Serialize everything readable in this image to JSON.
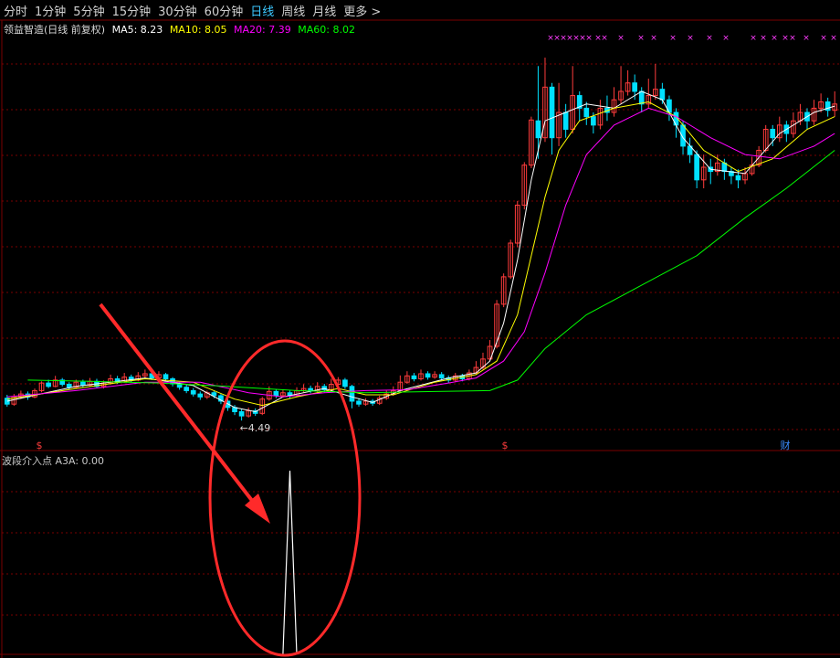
{
  "toolbar": {
    "items": [
      "分时",
      "1分钟",
      "5分钟",
      "15分钟",
      "30分钟",
      "60分钟",
      "日线",
      "周线",
      "月线"
    ],
    "active_index": 6,
    "more_label": "更多 >"
  },
  "legend": {
    "stock_label": "领益智造(日线 前复权)",
    "ma5": "MA5: 8.23",
    "ma10": "MA10: 8.05",
    "ma20": "MA20: 7.39",
    "ma60": "MA60: 8.02"
  },
  "colors": {
    "up": "#ff3c3c",
    "down": "#00e0ff",
    "ma5": "#ffffff",
    "ma10": "#ffff00",
    "ma20": "#ff00ff",
    "ma60": "#00ff00",
    "annotation": "#ff2a2a",
    "grid": "#7a0000"
  },
  "indicator": {
    "legend": "波段介入点 A3A: 0.00"
  },
  "markers": {
    "low_label": "←4.49",
    "s_glyph": "$",
    "fin_glyph": "财",
    "x_glyph": "×"
  },
  "chart_data": {
    "type": "candlestick",
    "y_range": [
      3.8,
      13.6
    ],
    "low_point": 4.49,
    "ma60_last": 8.02,
    "candles": [
      [
        5.02,
        4.88,
        5.1,
        4.82
      ],
      [
        4.88,
        5.06,
        5.12,
        4.84
      ],
      [
        5.06,
        5.12,
        5.2,
        5.0
      ],
      [
        5.12,
        5.05,
        5.18,
        4.98
      ],
      [
        5.05,
        5.2,
        5.25,
        5.02
      ],
      [
        5.2,
        5.38,
        5.42,
        5.16
      ],
      [
        5.38,
        5.3,
        5.46,
        5.26
      ],
      [
        5.3,
        5.45,
        5.55,
        5.28
      ],
      [
        5.45,
        5.35,
        5.5,
        5.3
      ],
      [
        5.35,
        5.28,
        5.4,
        5.22
      ],
      [
        5.28,
        5.4,
        5.46,
        5.24
      ],
      [
        5.4,
        5.33,
        5.46,
        5.28
      ],
      [
        5.33,
        5.42,
        5.5,
        5.3
      ],
      [
        5.42,
        5.3,
        5.48,
        5.26
      ],
      [
        5.3,
        5.38,
        5.44,
        5.25
      ],
      [
        5.38,
        5.48,
        5.58,
        5.34
      ],
      [
        5.48,
        5.4,
        5.55,
        5.36
      ],
      [
        5.4,
        5.52,
        5.62,
        5.38
      ],
      [
        5.52,
        5.45,
        5.58,
        5.4
      ],
      [
        5.45,
        5.55,
        5.64,
        5.42
      ],
      [
        5.55,
        5.6,
        5.7,
        5.5
      ],
      [
        5.6,
        5.5,
        5.66,
        5.45
      ],
      [
        5.5,
        5.58,
        5.66,
        5.46
      ],
      [
        5.58,
        5.48,
        5.62,
        5.42
      ],
      [
        5.48,
        5.36,
        5.52,
        5.3
      ],
      [
        5.36,
        5.28,
        5.4,
        5.22
      ],
      [
        5.28,
        5.2,
        5.34,
        5.14
      ],
      [
        5.2,
        5.12,
        5.26,
        5.06
      ],
      [
        5.12,
        5.05,
        5.18,
        4.98
      ],
      [
        5.05,
        5.15,
        5.2,
        5.0
      ],
      [
        5.15,
        5.08,
        5.2,
        5.02
      ],
      [
        5.08,
        4.95,
        5.12,
        4.88
      ],
      [
        4.95,
        4.8,
        5.0,
        4.72
      ],
      [
        4.8,
        4.7,
        4.86,
        4.62
      ],
      [
        4.7,
        4.6,
        4.76,
        4.49
      ],
      [
        4.6,
        4.72,
        4.8,
        4.56
      ],
      [
        4.72,
        4.66,
        4.78,
        4.6
      ],
      [
        4.66,
        5.0,
        5.05,
        4.62
      ],
      [
        5.0,
        5.18,
        5.3,
        4.96
      ],
      [
        5.18,
        5.08,
        5.24,
        5.02
      ],
      [
        5.08,
        5.15,
        5.22,
        5.04
      ],
      [
        5.15,
        5.08,
        5.2,
        5.02
      ],
      [
        5.08,
        5.2,
        5.28,
        5.05
      ],
      [
        5.2,
        5.25,
        5.35,
        5.16
      ],
      [
        5.25,
        5.2,
        5.32,
        5.14
      ],
      [
        5.2,
        5.3,
        5.4,
        5.16
      ],
      [
        5.3,
        5.22,
        5.36,
        5.16
      ],
      [
        5.22,
        5.35,
        5.48,
        5.18
      ],
      [
        5.35,
        5.45,
        5.52,
        5.3
      ],
      [
        5.45,
        5.3,
        5.5,
        5.24
      ],
      [
        5.3,
        4.95,
        5.34,
        4.78
      ],
      [
        4.95,
        4.88,
        5.02,
        4.82
      ],
      [
        4.88,
        4.95,
        5.02,
        4.84
      ],
      [
        4.95,
        4.9,
        5.0,
        4.84
      ],
      [
        4.9,
        5.02,
        5.08,
        4.86
      ],
      [
        5.02,
        5.12,
        5.2,
        4.98
      ],
      [
        5.12,
        5.2,
        5.3,
        5.08
      ],
      [
        5.2,
        5.4,
        5.56,
        5.16
      ],
      [
        5.4,
        5.55,
        5.66,
        5.36
      ],
      [
        5.55,
        5.48,
        5.62,
        5.42
      ],
      [
        5.48,
        5.6,
        5.7,
        5.44
      ],
      [
        5.6,
        5.52,
        5.66,
        5.46
      ],
      [
        5.52,
        5.58,
        5.66,
        5.48
      ],
      [
        5.58,
        5.5,
        5.64,
        5.44
      ],
      [
        5.5,
        5.45,
        5.56,
        5.38
      ],
      [
        5.45,
        5.55,
        5.62,
        5.4
      ],
      [
        5.55,
        5.48,
        5.6,
        5.42
      ],
      [
        5.48,
        5.62,
        5.7,
        5.44
      ],
      [
        5.62,
        5.75,
        5.9,
        5.58
      ],
      [
        5.75,
        5.95,
        6.1,
        5.7
      ],
      [
        5.95,
        6.25,
        6.4,
        5.9
      ],
      [
        6.25,
        7.25,
        7.35,
        6.2
      ],
      [
        7.25,
        7.9,
        7.98,
        7.18
      ],
      [
        7.9,
        8.7,
        8.78,
        7.85
      ],
      [
        8.7,
        9.6,
        9.7,
        8.6
      ],
      [
        9.6,
        10.55,
        10.62,
        9.5
      ],
      [
        10.55,
        11.62,
        11.7,
        10.48
      ],
      [
        11.6,
        11.2,
        12.9,
        10.7
      ],
      [
        11.2,
        12.4,
        13.1,
        11.1
      ],
      [
        12.4,
        11.2,
        12.5,
        10.8
      ],
      [
        11.2,
        11.8,
        12.5,
        11.0
      ],
      [
        11.8,
        11.4,
        12.0,
        11.2
      ],
      [
        11.4,
        12.2,
        12.9,
        11.3
      ],
      [
        12.2,
        11.9,
        12.3,
        11.6
      ],
      [
        11.9,
        11.7,
        12.05,
        11.5
      ],
      [
        11.7,
        11.5,
        11.8,
        11.3
      ],
      [
        11.5,
        11.9,
        12.1,
        11.4
      ],
      [
        11.9,
        11.8,
        12.2,
        11.6
      ],
      [
        11.8,
        12.1,
        12.4,
        11.7
      ],
      [
        12.1,
        12.3,
        12.9,
        12.0
      ],
      [
        12.3,
        12.5,
        12.8,
        12.2
      ],
      [
        12.5,
        12.3,
        12.7,
        12.1
      ],
      [
        12.3,
        12.0,
        12.4,
        11.8
      ],
      [
        12.0,
        12.2,
        12.6,
        11.9
      ],
      [
        12.2,
        12.35,
        12.95,
        12.1
      ],
      [
        12.35,
        12.1,
        12.5,
        12.0
      ],
      [
        12.1,
        11.8,
        12.2,
        11.6
      ],
      [
        11.8,
        11.5,
        11.9,
        11.2
      ],
      [
        11.5,
        11.0,
        11.6,
        10.8
      ],
      [
        11.0,
        10.8,
        11.2,
        10.6
      ],
      [
        10.8,
        10.2,
        10.9,
        10.0
      ],
      [
        10.2,
        10.5,
        10.8,
        10.0
      ],
      [
        10.5,
        10.4,
        10.7,
        10.1
      ],
      [
        10.4,
        10.6,
        10.8,
        10.3
      ],
      [
        10.6,
        10.4,
        10.7,
        10.2
      ],
      [
        10.4,
        10.3,
        10.5,
        10.1
      ],
      [
        10.3,
        10.2,
        10.45,
        10.0
      ],
      [
        10.2,
        10.35,
        10.5,
        10.1
      ],
      [
        10.35,
        10.55,
        10.75,
        10.3
      ],
      [
        10.55,
        10.9,
        11.0,
        10.5
      ],
      [
        10.9,
        11.4,
        11.5,
        10.85
      ],
      [
        11.4,
        11.2,
        11.5,
        11.0
      ],
      [
        11.2,
        11.5,
        11.7,
        11.1
      ],
      [
        11.5,
        11.3,
        11.6,
        11.1
      ],
      [
        11.3,
        11.6,
        11.8,
        11.2
      ],
      [
        11.6,
        11.8,
        12.0,
        11.5
      ],
      [
        11.8,
        11.6,
        11.9,
        11.4
      ],
      [
        11.6,
        11.9,
        12.1,
        11.5
      ],
      [
        11.9,
        12.05,
        12.25,
        11.8
      ],
      [
        12.05,
        11.85,
        12.15,
        11.7
      ],
      [
        11.85,
        12.0,
        12.3,
        11.7
      ]
    ],
    "ma_lines": {
      "MA5": [
        [
          0,
          4.95
        ],
        [
          10,
          5.3
        ],
        [
          20,
          5.5
        ],
        [
          27,
          5.32
        ],
        [
          33,
          4.8
        ],
        [
          36,
          4.7
        ],
        [
          40,
          5.05
        ],
        [
          46,
          5.25
        ],
        [
          50,
          5.05
        ],
        [
          53,
          4.92
        ],
        [
          57,
          5.2
        ],
        [
          64,
          5.5
        ],
        [
          68,
          5.62
        ],
        [
          70,
          5.9
        ],
        [
          72,
          6.8
        ],
        [
          74,
          8.3
        ],
        [
          76,
          10.2
        ],
        [
          78,
          11.6
        ],
        [
          81,
          11.8
        ],
        [
          84,
          12.0
        ],
        [
          88,
          11.9
        ],
        [
          92,
          12.3
        ],
        [
          95,
          12.1
        ],
        [
          98,
          11.2
        ],
        [
          102,
          10.45
        ],
        [
          107,
          10.35
        ],
        [
          112,
          11.3
        ],
        [
          117,
          11.8
        ],
        [
          120,
          11.95
        ]
      ],
      "MA10": [
        [
          0,
          5.0
        ],
        [
          10,
          5.25
        ],
        [
          20,
          5.48
        ],
        [
          27,
          5.4
        ],
        [
          33,
          5.0
        ],
        [
          37,
          4.85
        ],
        [
          42,
          5.05
        ],
        [
          48,
          5.25
        ],
        [
          52,
          5.1
        ],
        [
          56,
          5.1
        ],
        [
          62,
          5.4
        ],
        [
          68,
          5.58
        ],
        [
          71,
          5.9
        ],
        [
          74,
          7.0
        ],
        [
          76,
          8.4
        ],
        [
          78,
          9.8
        ],
        [
          80,
          10.9
        ],
        [
          83,
          11.6
        ],
        [
          88,
          11.9
        ],
        [
          93,
          12.05
        ],
        [
          97,
          11.7
        ],
        [
          101,
          10.9
        ],
        [
          106,
          10.4
        ],
        [
          111,
          10.7
        ],
        [
          116,
          11.4
        ],
        [
          120,
          11.7
        ]
      ],
      "MA20": [
        [
          0,
          5.05
        ],
        [
          10,
          5.2
        ],
        [
          20,
          5.4
        ],
        [
          28,
          5.4
        ],
        [
          35,
          5.15
        ],
        [
          40,
          5.05
        ],
        [
          46,
          5.15
        ],
        [
          52,
          5.2
        ],
        [
          58,
          5.22
        ],
        [
          64,
          5.38
        ],
        [
          68,
          5.5
        ],
        [
          72,
          5.9
        ],
        [
          75,
          6.6
        ],
        [
          78,
          8.0
        ],
        [
          81,
          9.6
        ],
        [
          84,
          10.8
        ],
        [
          88,
          11.5
        ],
        [
          93,
          11.9
        ],
        [
          97,
          11.7
        ],
        [
          102,
          11.2
        ],
        [
          107,
          10.8
        ],
        [
          112,
          10.7
        ],
        [
          117,
          11.0
        ],
        [
          120,
          11.3
        ]
      ],
      "MA60": [
        [
          3,
          5.45
        ],
        [
          12,
          5.42
        ],
        [
          22,
          5.38
        ],
        [
          32,
          5.3
        ],
        [
          42,
          5.2
        ],
        [
          52,
          5.15
        ],
        [
          62,
          5.18
        ],
        [
          70,
          5.2
        ],
        [
          74,
          5.45
        ],
        [
          78,
          6.2
        ],
        [
          84,
          7.0
        ],
        [
          92,
          7.7
        ],
        [
          100,
          8.4
        ],
        [
          107,
          9.3
        ],
        [
          113,
          10.0
        ],
        [
          120,
          10.9
        ]
      ]
    },
    "indicator_a3a": [
      [
        40,
        0
      ],
      [
        41,
        1
      ],
      [
        42,
        0
      ]
    ],
    "indicator_range": [
      0,
      1
    ]
  }
}
